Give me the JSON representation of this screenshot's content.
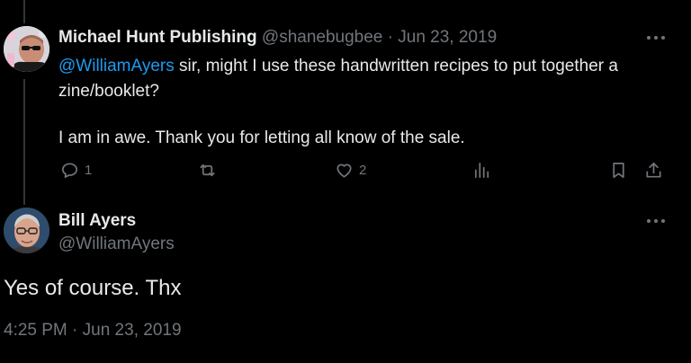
{
  "reply": {
    "author_name": "Michael Hunt Publishing",
    "author_handle": "@shanebugbee",
    "separator": "·",
    "date": "Jun 23, 2019",
    "mention": "@WilliamAyers",
    "text_line1_rest": " sir, might I use these handwritten recipes to put together a zine/booklet?",
    "text_paragraph2": "I am in awe. Thank you for letting all know of the sale.",
    "actions": {
      "reply_count": "1",
      "retweet_count": "",
      "like_count": "2"
    }
  },
  "main": {
    "author_name": "Bill Ayers",
    "author_handle": "@WilliamAyers",
    "text": "Yes of course. Thx",
    "timestamp": "4:25 PM · Jun 23, 2019"
  },
  "icons": {
    "reply": "comment-icon",
    "retweet": "retweet-icon",
    "like": "heart-icon",
    "views": "analytics-icon",
    "bookmark": "bookmark-icon",
    "share": "share-icon",
    "more": "more-icon"
  },
  "colors": {
    "background": "#000000",
    "text": "#e7e9ea",
    "muted": "#71767b",
    "link": "#1d9bf0"
  }
}
